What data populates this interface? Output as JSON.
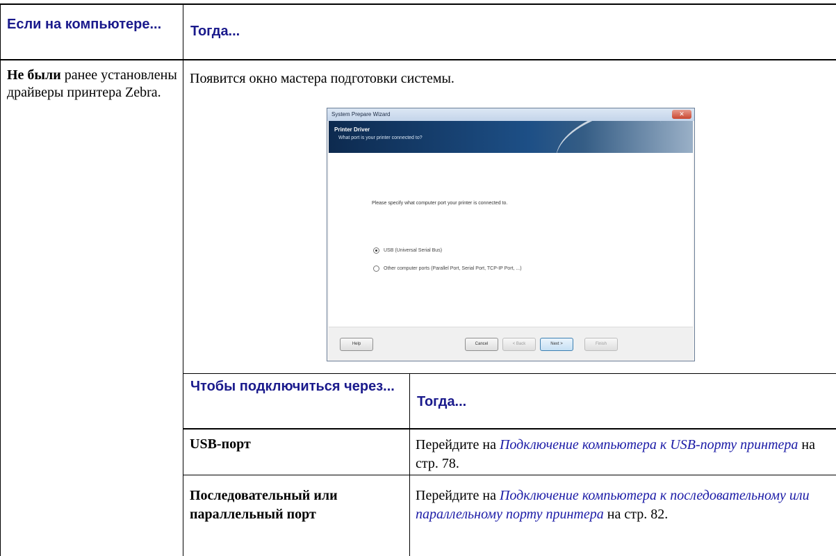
{
  "table": {
    "header_left": "Если на компьютере...",
    "header_right": "Тогда...",
    "row1_condition_bold": "Не были",
    "row1_condition_rest": " ранее установлены драйверы принтера Zebra.",
    "row1_result": "Появится окно мастера подготовки системы."
  },
  "dialog": {
    "title": "System Prepare Wizard",
    "close": "✕",
    "banner_title": "Printer Driver",
    "banner_subtitle": "What port is your printer connected to?",
    "prompt": "Please specify what computer port your printer is connected to.",
    "options": [
      {
        "label": "USB (Universal Serial Bus)",
        "selected": true
      },
      {
        "label": "Other computer ports (Parallel Port, Serial Port, TCP-IP Port, ...)",
        "selected": false
      }
    ],
    "buttons": {
      "help": "Help",
      "cancel": "Cancel",
      "back": "< Back",
      "next": "Next >",
      "finish": "Finish"
    }
  },
  "subtable": {
    "header_left": "Чтобы подключиться через...",
    "header_right": "Тогда...",
    "rows": [
      {
        "condition": "USB-порт",
        "prefix": "Перейдите на ",
        "link": "Подключение компьютера к USB-порту принтера",
        "suffix": " на стр. 78."
      },
      {
        "condition": "Последовательный или параллельный порт",
        "prefix": "Перейдите на ",
        "link": "Подключение компьютера к последовательному или параллельному порту принтера",
        "suffix": " на стр. 82."
      }
    ]
  }
}
